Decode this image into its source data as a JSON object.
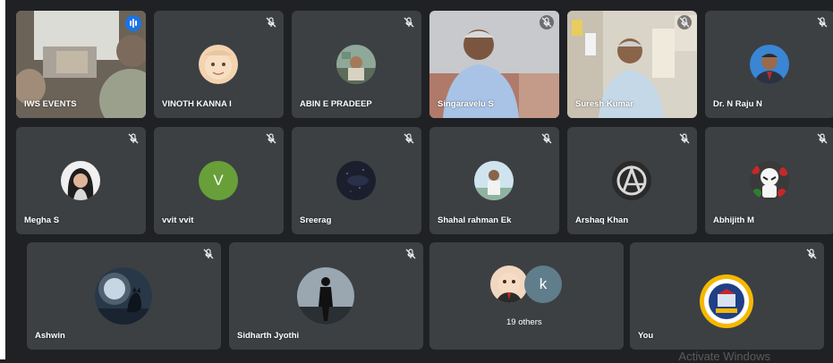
{
  "participants": [
    {
      "name": "IWS EVENTS",
      "status": "speaking"
    },
    {
      "name": "VINOTH KANNA I",
      "status": "muted"
    },
    {
      "name": "ABIN E PRADEEP",
      "status": "muted"
    },
    {
      "name": "Singaravelu S",
      "status": "muted"
    },
    {
      "name": "Suresh Kumar",
      "status": "muted"
    },
    {
      "name": "Dr. N Raju N",
      "status": "muted"
    },
    {
      "name": "Megha S",
      "status": "muted"
    },
    {
      "name": "vvit vvit",
      "status": "muted",
      "initial": "V"
    },
    {
      "name": "Sreerag",
      "status": "muted"
    },
    {
      "name": "Shahal rahman Ek",
      "status": "muted"
    },
    {
      "name": "Arshaq Khan",
      "status": "muted"
    },
    {
      "name": "Abhijith M",
      "status": "muted"
    },
    {
      "name": "Ashwin",
      "status": "muted"
    },
    {
      "name": "Sidharth Jyothi",
      "status": "muted"
    },
    {
      "name": "You",
      "status": "muted"
    }
  ],
  "others": {
    "label": "19 others",
    "initial": "k"
  },
  "watermark": "Activate Windows",
  "colors": {
    "background": "#202124",
    "tile": "#3c4043",
    "active_border": "#8ab4f8",
    "speaking_badge": "#1a73e8",
    "letter_avatar_v": "#689f38",
    "letter_avatar_k": "#607d8b"
  },
  "icons": {
    "muted": "mic-off-icon",
    "speaking": "audio-level-icon"
  }
}
